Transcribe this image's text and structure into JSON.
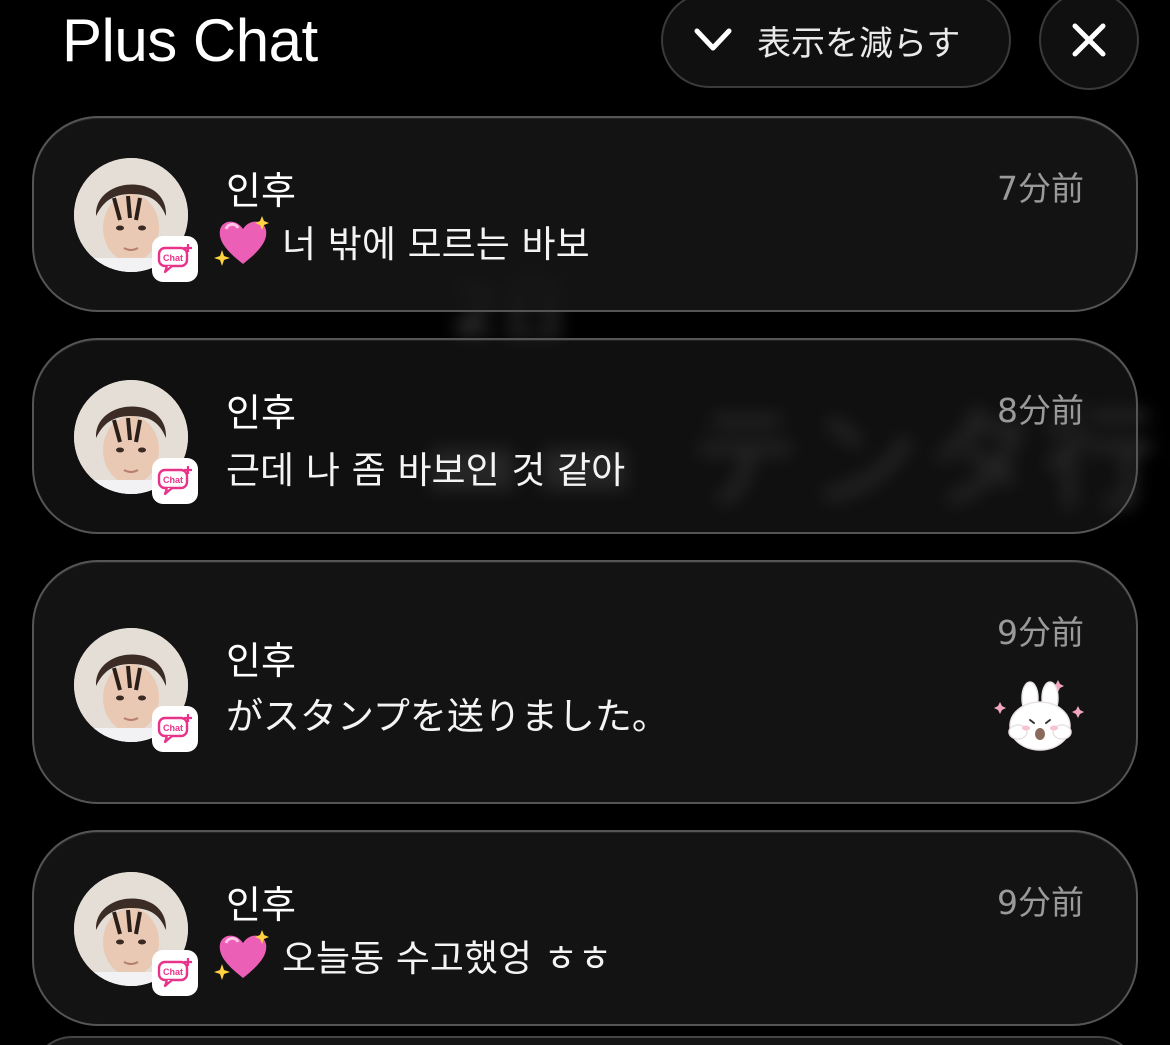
{
  "header": {
    "title": "Plus Chat",
    "show_less_label": "表示を減らす",
    "show_less_icon": "chevron-down-icon",
    "close_icon": "close-icon"
  },
  "notifications": [
    {
      "sender": "인후",
      "emoji": "sparkling-heart-icon",
      "message": "너 밖에 모르는 바보",
      "time": "7分前",
      "badge": "Chat"
    },
    {
      "sender": "인후",
      "message": "근데 나 좀 바보인 것 같아",
      "time": "8分前",
      "badge": "Chat"
    },
    {
      "sender": "인후",
      "message": "がスタンプを送りました。",
      "time": "9分前",
      "badge": "Chat",
      "sticker": "bunny-sticker-icon"
    },
    {
      "sender": "인후",
      "emoji": "sparkling-heart-icon",
      "message": "오늘동 수고했엉 ㅎㅎ",
      "time": "9分前",
      "badge": "Chat"
    }
  ],
  "colors": {
    "background": "#000000",
    "card": "#161616",
    "time_text": "#9a9a9a",
    "badge_pink": "#e8338a"
  }
}
